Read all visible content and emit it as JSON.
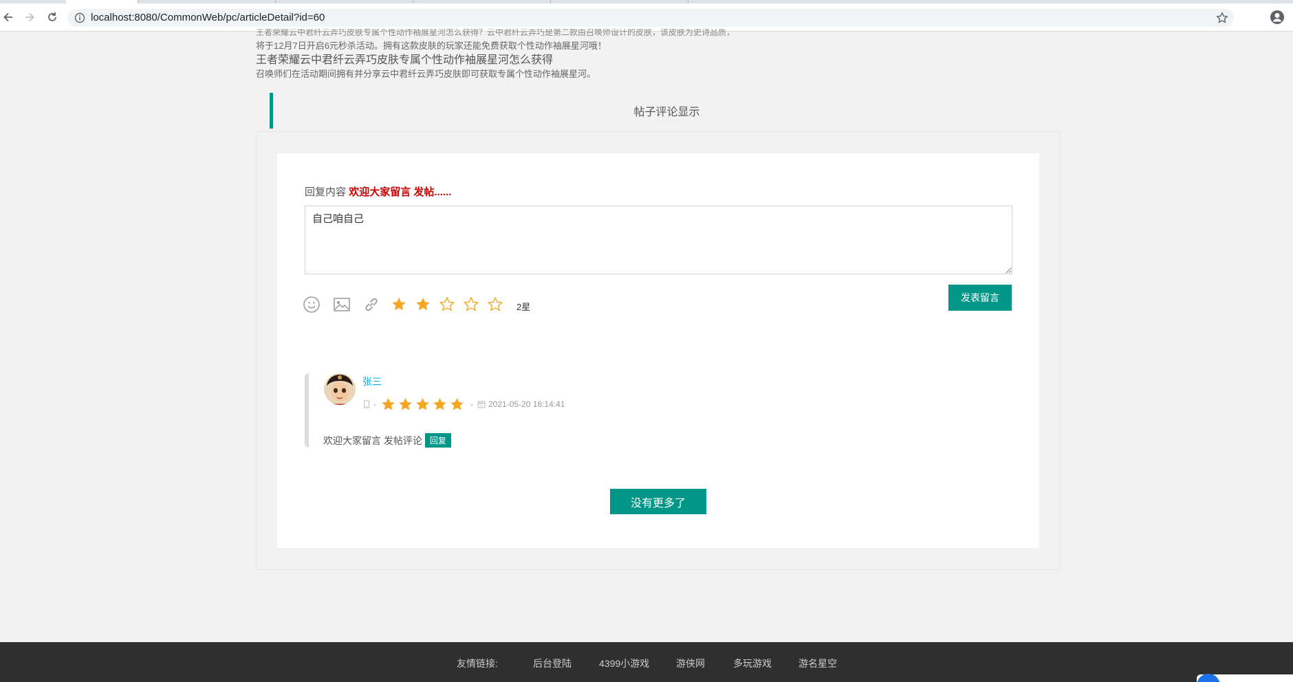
{
  "browser": {
    "url": "localhost:8080/CommonWeb/pc/articleDetail?id=60"
  },
  "article": {
    "line1": "王者荣耀云中君纤云弄巧皮肤专属个性动作袖展星河怎么获得？云中君纤云弄巧是第二款由召唤师设计的皮肤，该皮肤为史诗品质，",
    "line2": "将于12月7日开启6元秒杀活动。拥有这款皮肤的玩家还能免费获取个性动作袖展星河哦！",
    "title": "王者荣耀云中君纤云弄巧皮肤专属个性动作袖展星河怎么获得",
    "summary": "召唤师们在活动期间拥有并分享云中君纤云弄巧皮肤即可获取专属个性动作袖展星河。"
  },
  "section_title": "帖子评论显示",
  "reply_form": {
    "label": "回复内容",
    "hint": "欢迎大家留言 发帖......",
    "value": "自己咱自己",
    "rating_text": "2星",
    "rating": 2,
    "rating_max": 5,
    "submit_label": "发表留言"
  },
  "comment": {
    "author": "张三",
    "rating": 5,
    "timestamp": "2021-05-20 16:14:41",
    "text": "欢迎大家留言 发帖评论",
    "reply_label": "回复"
  },
  "no_more_label": "没有更多了",
  "footer": {
    "label": "友情链接:",
    "links": [
      "后台登陆",
      "4399小游戏",
      "游侠网",
      "多玩游戏",
      "游名星空"
    ]
  },
  "colors": {
    "accent": "#009688",
    "star": "#f5a623",
    "hint": "#cc0000",
    "footer_bg": "#2f2f2f"
  },
  "icons": [
    "back-icon",
    "forward-icon",
    "reload-icon",
    "info-icon",
    "bookmark-star-icon",
    "profile-icon",
    "emoji-icon",
    "image-icon",
    "link-icon",
    "star-icon",
    "device-icon",
    "calendar-icon"
  ]
}
